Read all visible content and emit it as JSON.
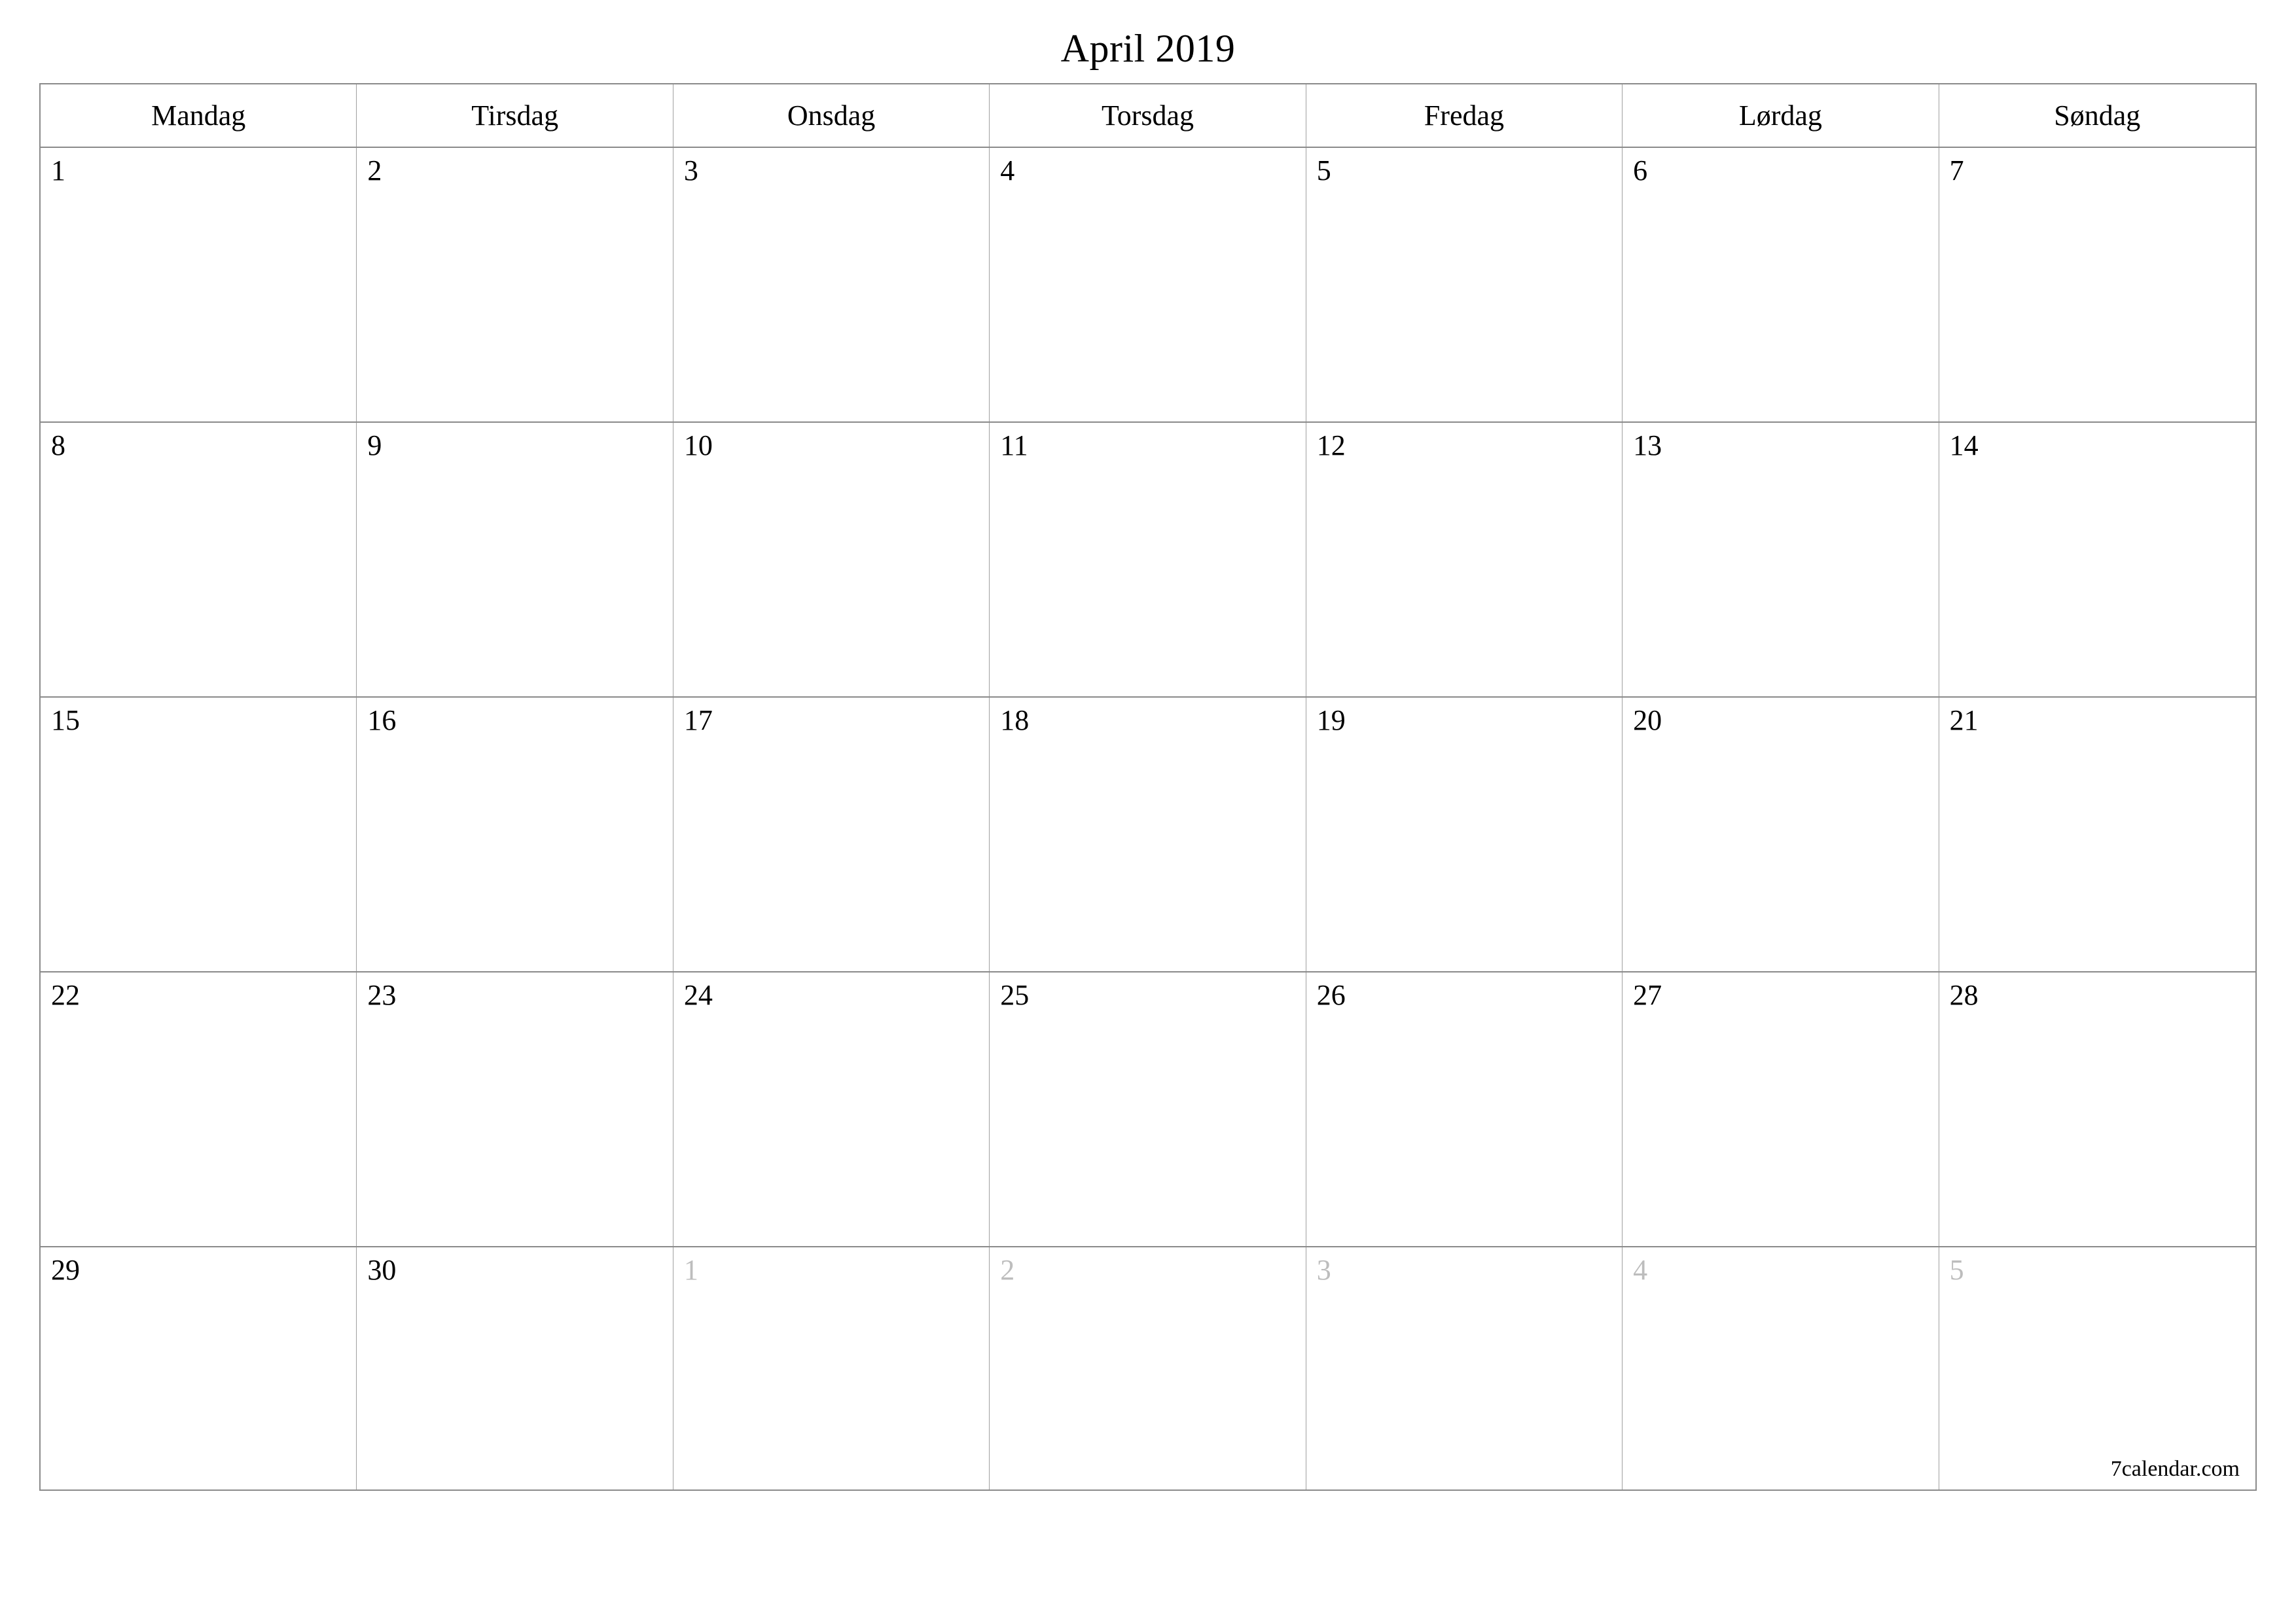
{
  "title": "April 2019",
  "footer": "7calendar.com",
  "weekdays": [
    "Mandag",
    "Tirsdag",
    "Onsdag",
    "Torsdag",
    "Fredag",
    "Lørdag",
    "Søndag"
  ],
  "weeks": [
    [
      {
        "n": "1",
        "other": false
      },
      {
        "n": "2",
        "other": false
      },
      {
        "n": "3",
        "other": false
      },
      {
        "n": "4",
        "other": false
      },
      {
        "n": "5",
        "other": false
      },
      {
        "n": "6",
        "other": false
      },
      {
        "n": "7",
        "other": false
      }
    ],
    [
      {
        "n": "8",
        "other": false
      },
      {
        "n": "9",
        "other": false
      },
      {
        "n": "10",
        "other": false
      },
      {
        "n": "11",
        "other": false
      },
      {
        "n": "12",
        "other": false
      },
      {
        "n": "13",
        "other": false
      },
      {
        "n": "14",
        "other": false
      }
    ],
    [
      {
        "n": "15",
        "other": false
      },
      {
        "n": "16",
        "other": false
      },
      {
        "n": "17",
        "other": false
      },
      {
        "n": "18",
        "other": false
      },
      {
        "n": "19",
        "other": false
      },
      {
        "n": "20",
        "other": false
      },
      {
        "n": "21",
        "other": false
      }
    ],
    [
      {
        "n": "22",
        "other": false
      },
      {
        "n": "23",
        "other": false
      },
      {
        "n": "24",
        "other": false
      },
      {
        "n": "25",
        "other": false
      },
      {
        "n": "26",
        "other": false
      },
      {
        "n": "27",
        "other": false
      },
      {
        "n": "28",
        "other": false
      }
    ],
    [
      {
        "n": "29",
        "other": false
      },
      {
        "n": "30",
        "other": false
      },
      {
        "n": "1",
        "other": true
      },
      {
        "n": "2",
        "other": true
      },
      {
        "n": "3",
        "other": true
      },
      {
        "n": "4",
        "other": true
      },
      {
        "n": "5",
        "other": true
      }
    ]
  ]
}
